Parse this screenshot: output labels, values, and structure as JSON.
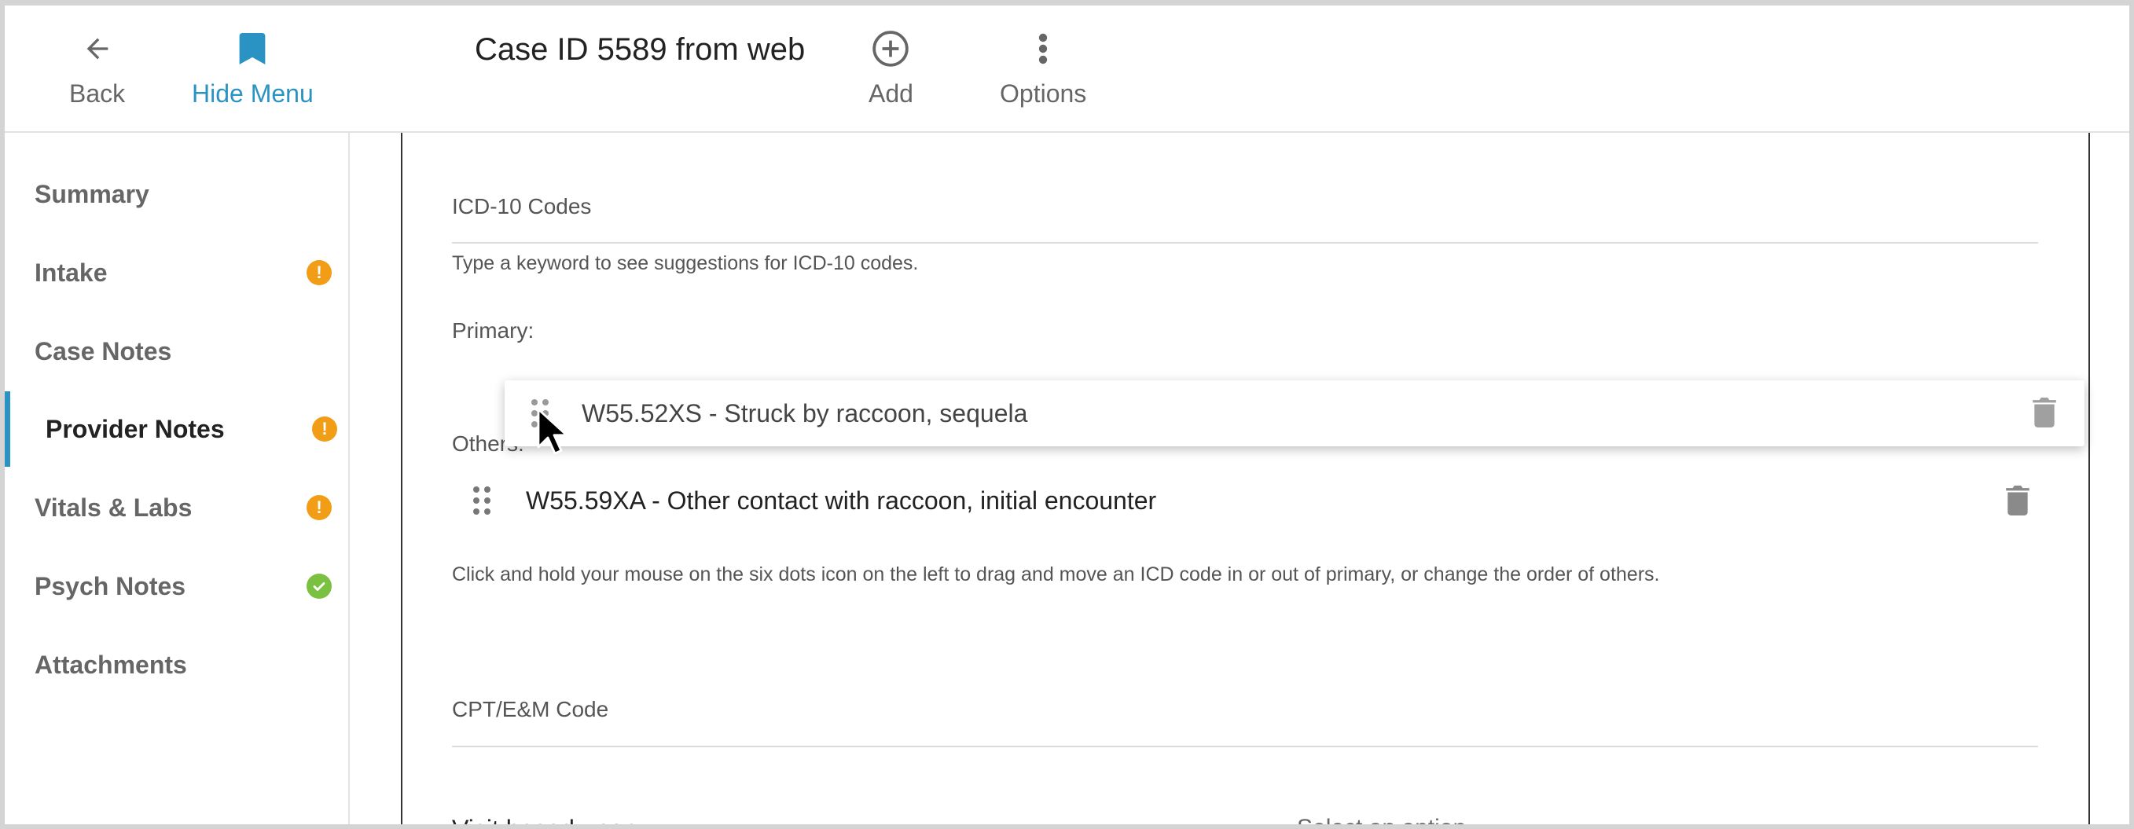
{
  "header": {
    "back_label": "Back",
    "hide_menu_label": "Hide Menu",
    "title": "Case ID 5589 from web",
    "add_label": "Add",
    "options_label": "Options"
  },
  "sidebar": {
    "items": [
      {
        "label": "Summary",
        "badge": null
      },
      {
        "label": "Intake",
        "badge": "!"
      },
      {
        "label": "Case Notes",
        "badge": null
      },
      {
        "label": "Provider Notes",
        "badge": "!",
        "active": true
      },
      {
        "label": "Vitals & Labs",
        "badge": "!"
      },
      {
        "label": "Psych Notes",
        "badge": "check"
      },
      {
        "label": "Attachments",
        "badge": null
      }
    ]
  },
  "main": {
    "icd_title": "ICD-10 Codes",
    "icd_helper": "Type a keyword to see suggestions for ICD-10 codes.",
    "primary_label": "Primary:",
    "others_label": "Others:",
    "dragging_code": "W55.52XS - Struck by raccoon, sequela",
    "other_codes": [
      "W55.59XA - Other contact with raccoon, initial encounter"
    ],
    "drag_instructions": "Click and hold your mouse on the six dots icon on the left to drag and move an ICD code in or out of primary, or change the order of others.",
    "cpt_title": "CPT/E&M Code",
    "visit_label": "Visit based upon",
    "visit_placeholder": "Select an option"
  },
  "colors": {
    "accent": "#2a93c4",
    "warning": "#f29d16",
    "success": "#7ac142"
  }
}
